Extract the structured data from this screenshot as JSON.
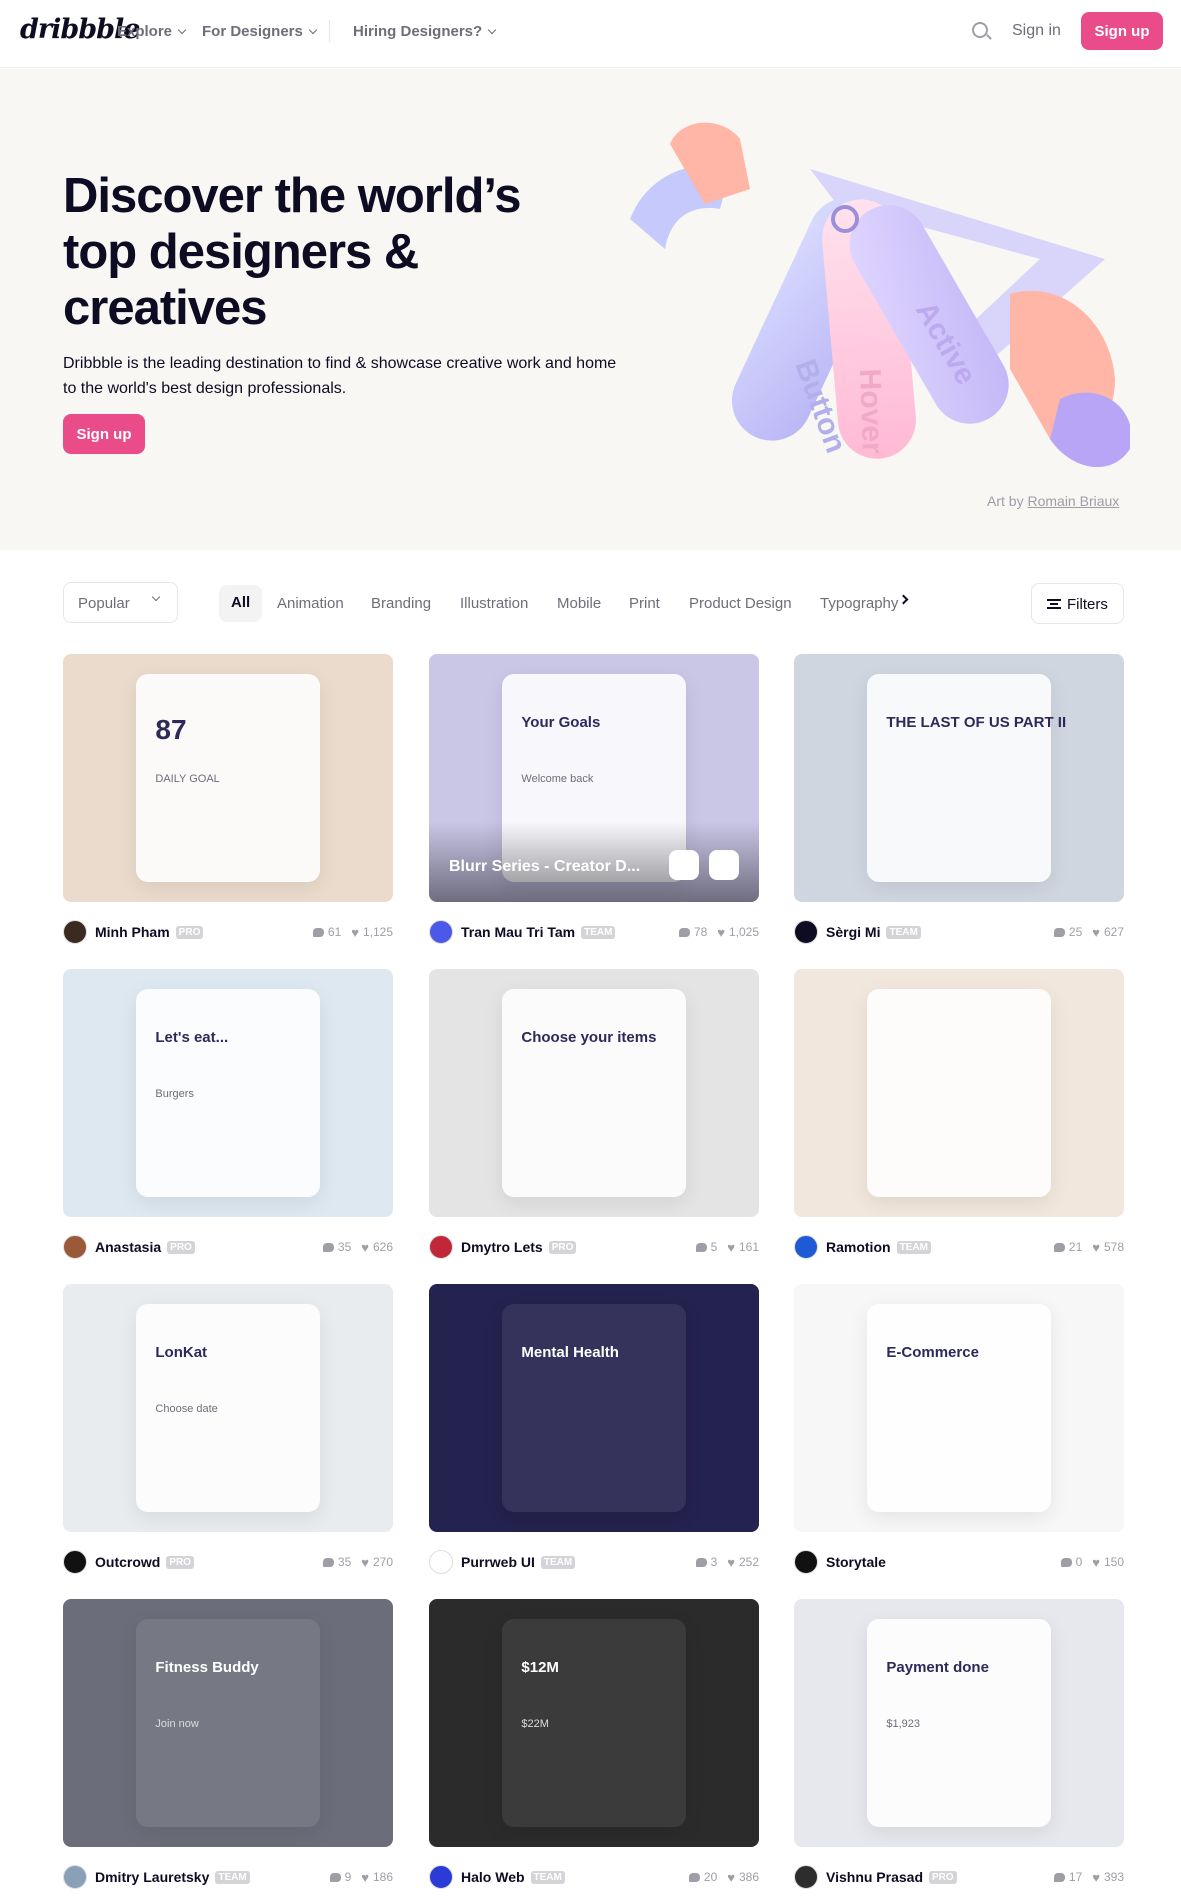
{
  "nav": {
    "logo": "dribbble",
    "items": [
      "Explore",
      "For Designers",
      "Hiring Designers?"
    ],
    "sign_in": "Sign in",
    "sign_up": "Sign up"
  },
  "hero": {
    "title": "Discover the world’s top designers & creatives",
    "subtitle": "Dribbble is the leading destination to find & showcase creative work and home to the world's best design professionals.",
    "cta": "Sign up",
    "art_by_prefix": "Art by",
    "art_by_name": "Romain Briaux",
    "tags": [
      "Button",
      "Hover",
      "Active"
    ]
  },
  "filters": {
    "sort": "Popular",
    "categories": [
      "All",
      "Animation",
      "Branding",
      "Illustration",
      "Mobile",
      "Print",
      "Product Design",
      "Typography"
    ],
    "active_category": "All",
    "filters_label": "Filters"
  },
  "shots": [
    {
      "author": "Minh Pham",
      "badge": "PRO",
      "comments": "61",
      "likes": "1,125",
      "title": "",
      "bg": "#eadbcc",
      "avatar": "#3a2a22"
    },
    {
      "author": "Tran Mau Tri Tam",
      "badge": "TEAM",
      "comments": "78",
      "likes": "1,025",
      "title": "Blurr Series - Creator D...",
      "bg": "#c9c6e6",
      "avatar": "#4b58e8"
    },
    {
      "author": "Sèrgi Mi",
      "badge": "TEAM",
      "comments": "25",
      "likes": "627",
      "title": "",
      "bg": "#cfd6e0",
      "avatar": "#0d0c22"
    },
    {
      "author": "Anastasia",
      "badge": "PRO",
      "comments": "35",
      "likes": "626",
      "title": "",
      "bg": "#dde8f0",
      "avatar": "#9a5a3a"
    },
    {
      "author": "Dmytro Lets",
      "badge": "PRO",
      "comments": "5",
      "likes": "161",
      "title": "",
      "bg": "#e4e4e4",
      "avatar": "#c0283a"
    },
    {
      "author": "Ramotion",
      "badge": "TEAM",
      "comments": "21",
      "likes": "578",
      "title": "",
      "bg": "#f1e7dc",
      "avatar": "#1f5ad6"
    },
    {
      "author": "Outcrowd",
      "badge": "PRO",
      "comments": "35",
      "likes": "270",
      "title": "",
      "bg": "#e9ecef",
      "avatar": "#111111"
    },
    {
      "author": "Purrweb UI",
      "badge": "TEAM",
      "comments": "3",
      "likes": "252",
      "title": "",
      "bg": "#24224e",
      "avatar": "#ffffff"
    },
    {
      "author": "Storytale",
      "badge": "",
      "comments": "0",
      "likes": "150",
      "title": "",
      "bg": "#f7f7f7",
      "avatar": "#111111"
    },
    {
      "author": "Dmitry Lauretsky",
      "badge": "TEAM",
      "comments": "9",
      "likes": "186",
      "title": "",
      "bg": "#6b6e7a",
      "avatar": "#8aa0b8"
    },
    {
      "author": "Halo Web",
      "badge": "TEAM",
      "comments": "20",
      "likes": "386",
      "title": "",
      "bg": "#2b2b2b",
      "avatar": "#2a3bd6"
    },
    {
      "author": "Vishnu Prasad",
      "badge": "PRO",
      "comments": "17",
      "likes": "393",
      "title": "",
      "bg": "#e6e8ee",
      "avatar": "#2d2d2d"
    }
  ],
  "shot_art": [
    {
      "text": "87",
      "sub": "DAILY GOAL"
    },
    {
      "text": "Your Goals",
      "sub": "Welcome back"
    },
    {
      "text": "THE LAST OF US PART II",
      "sub": ""
    },
    {
      "text": "Let's eat...",
      "sub": "Burgers"
    },
    {
      "text": "Choose your items",
      "sub": ""
    },
    {
      "text": "",
      "sub": ""
    },
    {
      "text": "LonKat",
      "sub": "Choose date"
    },
    {
      "text": "Mental Health",
      "sub": ""
    },
    {
      "text": "E-Commerce",
      "sub": ""
    },
    {
      "text": "Fitness Buddy",
      "sub": "Join now"
    },
    {
      "text": "$12M",
      "sub": "$22M"
    },
    {
      "text": "Payment done",
      "sub": "$1,923"
    }
  ]
}
